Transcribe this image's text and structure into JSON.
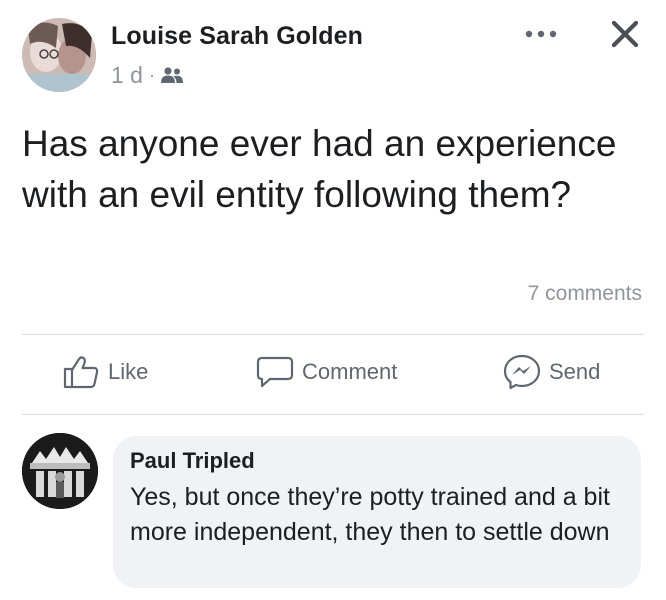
{
  "post": {
    "author": "Louise Sarah Golden",
    "timestamp": "1 d",
    "audience_icon": "friends-icon",
    "text": "Has anyone ever had an experience with an evil entity following them?",
    "comment_count": "7 comments",
    "more_icon": "more-options-icon",
    "close_icon": "close-icon"
  },
  "actions": {
    "like": "Like",
    "comment": "Comment",
    "send": "Send"
  },
  "comment": {
    "author": "Paul Tripled",
    "text": "Yes, but once they’re potty trained and a bit more independent, they then to settle down"
  },
  "colors": {
    "text": "#1c1e21",
    "muted": "#90949c",
    "action": "#606770",
    "bubble": "#f0f2f5",
    "divider": "#dadde1"
  }
}
